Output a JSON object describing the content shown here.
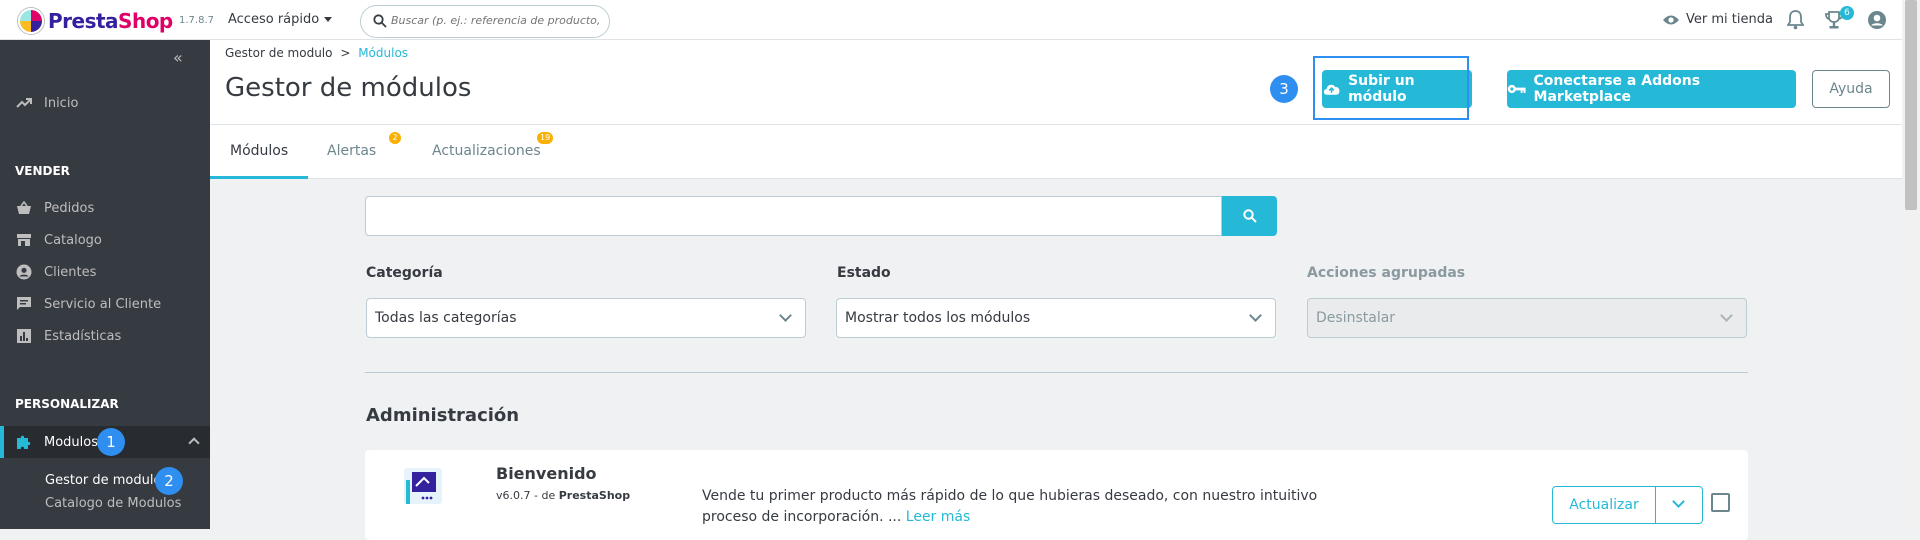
{
  "topbar": {
    "logo_prefix": "Presta",
    "logo_suffix": "Shop",
    "version": "1.7.8.7",
    "quick_access": "Acceso rápido",
    "search_placeholder": "Buscar (p. ej.: referencia de producto,",
    "view_shop": "Ver mi tienda",
    "trophy_count": "6"
  },
  "sidebar": {
    "collapse_glyph": "«",
    "home": "Inicio",
    "sections": {
      "sell": "VENDER",
      "customize": "PERSONALIZAR"
    },
    "sell_items": [
      "Pedidos",
      "Catalogo",
      "Clientes",
      "Servicio al Cliente",
      "Estadísticas"
    ],
    "modules": "Modulos",
    "sub_items": [
      "Gestor de modulo",
      "Catalogo de Modulos"
    ]
  },
  "steps": [
    "1",
    "2",
    "3"
  ],
  "header": {
    "breadcrumb_parent": "Gestor de modulo",
    "breadcrumb_sep": ">",
    "breadcrumb_current": "Módulos",
    "title": "Gestor de módulos",
    "upload_button": "Subir un módulo",
    "connect_button": "Conectarse a Addons Marketplace",
    "help_button": "Ayuda"
  },
  "tabs": [
    {
      "label": "Módulos",
      "badge": ""
    },
    {
      "label": "Alertas",
      "badge": "2"
    },
    {
      "label": "Actualizaciones",
      "badge": "19"
    }
  ],
  "filters": {
    "category_label": "Categoría",
    "category_value": "Todas las categorías",
    "status_label": "Estado",
    "status_value": "Mostrar todos los módulos",
    "bulk_label": "Acciones agrupadas",
    "bulk_value": "Desinstalar"
  },
  "section_title": "Administración",
  "module": {
    "name": "Bienvenido",
    "version": "v6.0.7 - de",
    "author": "PrestaShop",
    "description": "Vende tu primer producto más rápido de lo que hubieras deseado, con nuestro intuitivo proceso de incorporación. ...",
    "read_more": "Leer más",
    "update_button": "Actualizar"
  },
  "colors": {
    "accent": "#25b9d7",
    "sidebar": "#363a41",
    "step_badge": "#2e8ff0",
    "tab_badge": "#fab000"
  }
}
